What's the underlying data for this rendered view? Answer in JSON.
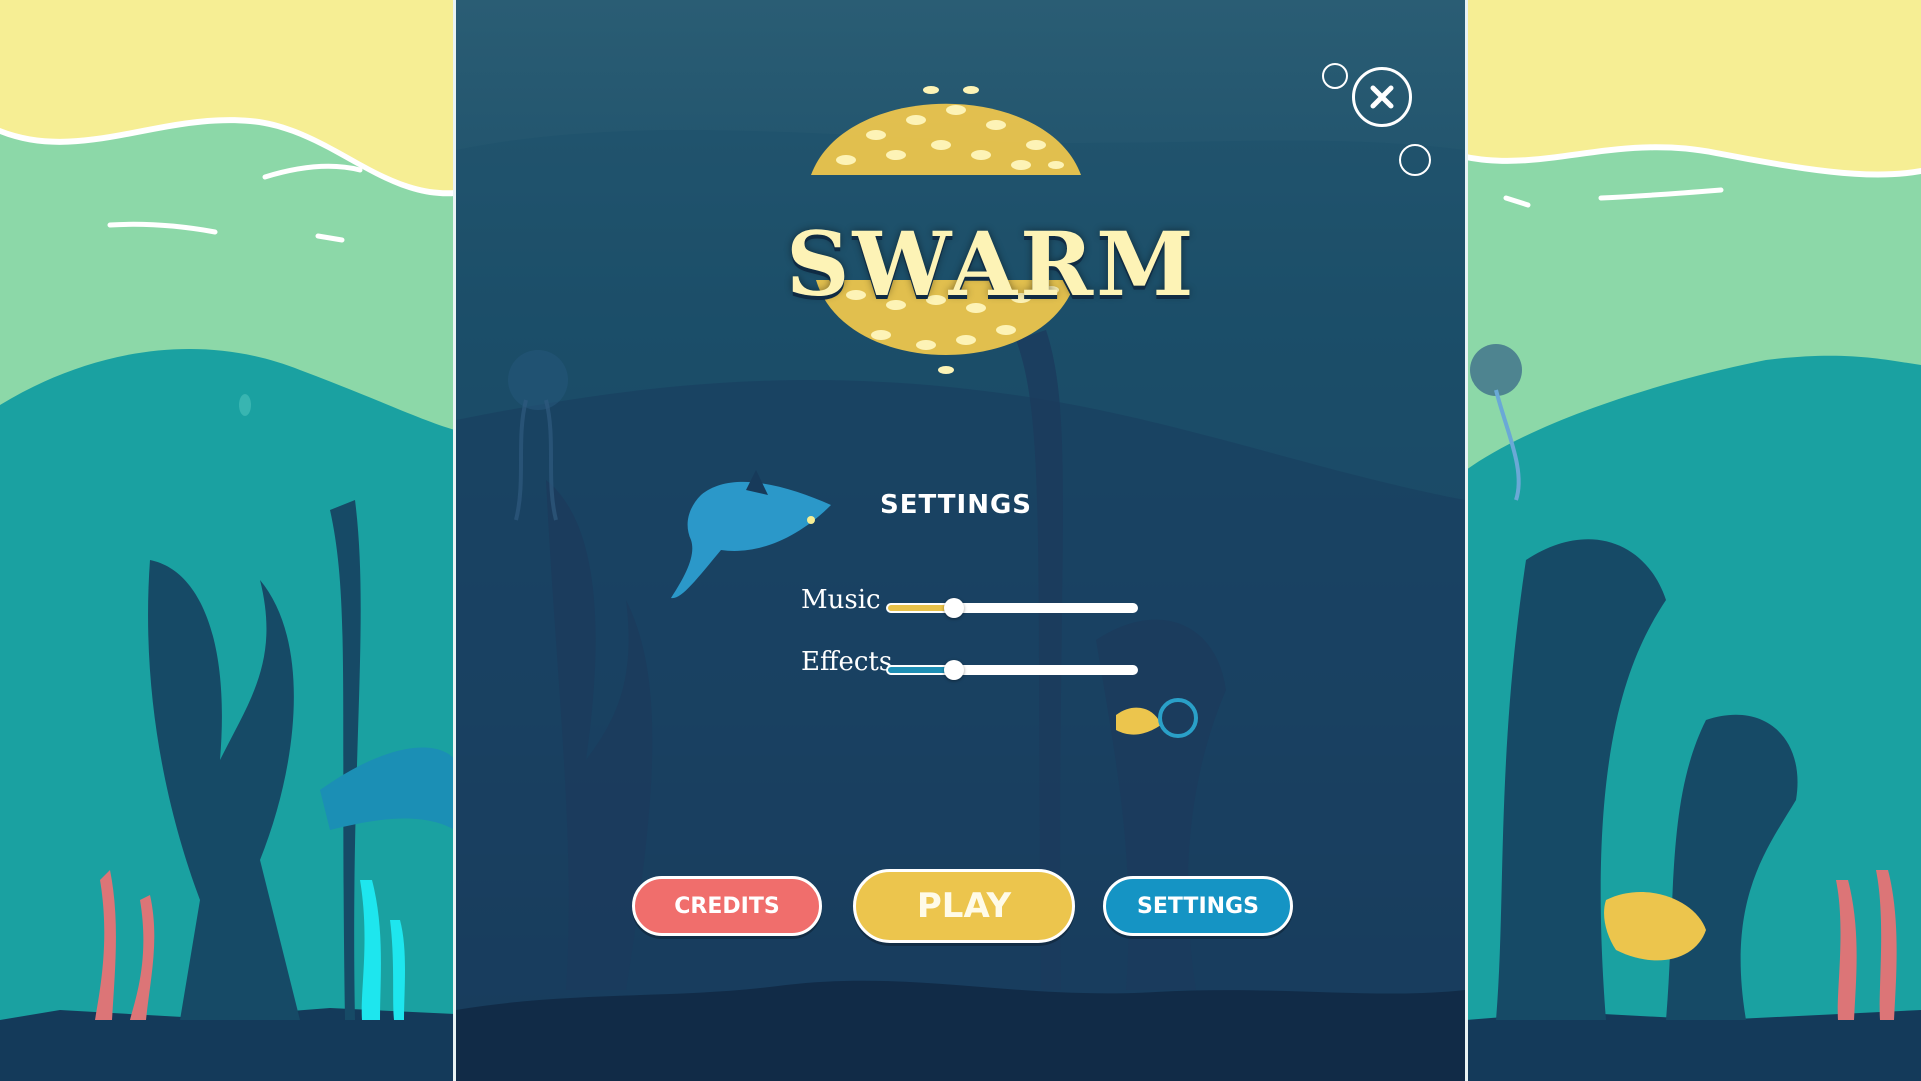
{
  "game": {
    "title": "SWARM"
  },
  "settings": {
    "heading": "SETTINGS",
    "music": {
      "label": "Music",
      "level": 0.27,
      "fill_color": "#e8c24a"
    },
    "effects": {
      "label": "Effects",
      "level": 0.27,
      "fill_color": "#1e8fb5"
    }
  },
  "menu": {
    "credits_label": "CREDITS",
    "play_label": "PLAY",
    "settings_label": "SETTINGS"
  },
  "icons": {
    "close": "close-icon"
  },
  "colors": {
    "sand": "#f6ee94",
    "shallow": "#8cd8a8",
    "sea": "#1aa1a1",
    "deep": "#1a3f62",
    "credits": "#f06e6c",
    "play": "#ecc54d",
    "settings": "#1594c4"
  }
}
